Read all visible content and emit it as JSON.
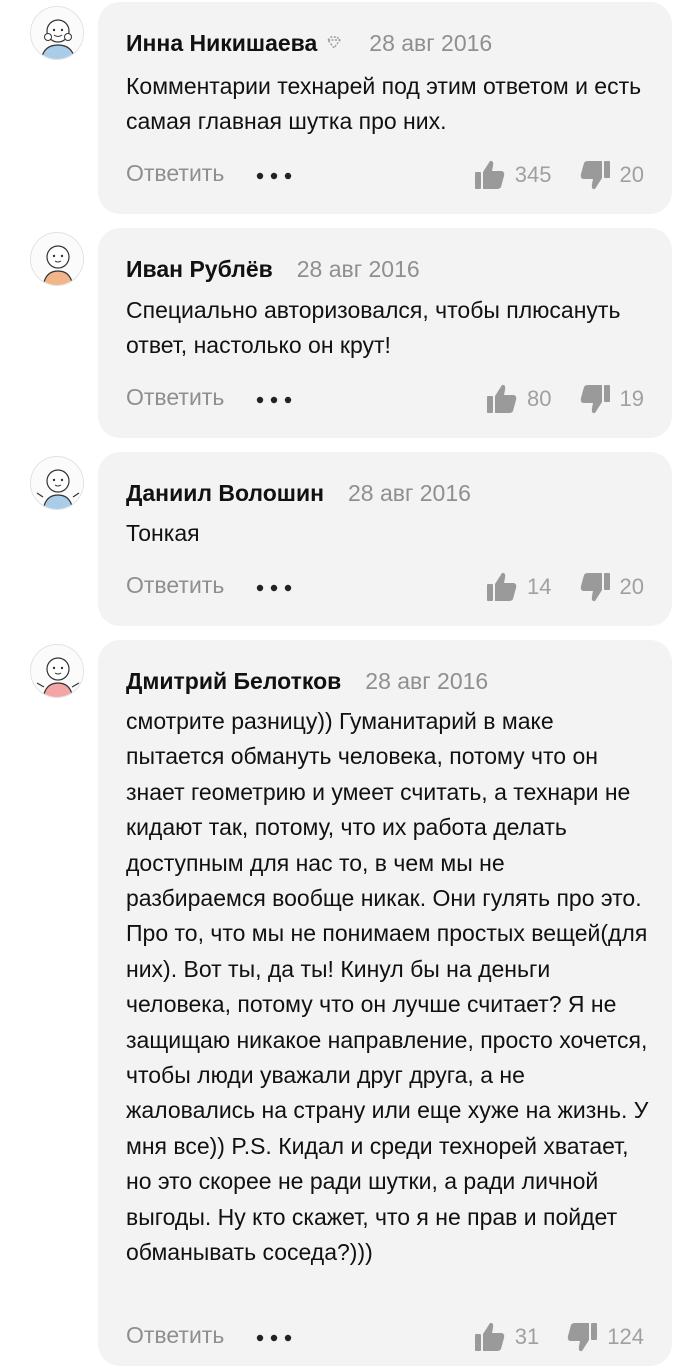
{
  "comments": [
    {
      "author": "Инна Никишаева",
      "has_badge": true,
      "date": "28 авг 2016",
      "text": "Комментарии технарей под этим ответом и есть самая главная шутка про них.",
      "reply_label": "Ответить",
      "likes": "345",
      "dislikes": "20",
      "avatar_shirt_color": "#a9cce8"
    },
    {
      "author": "Иван Рублёв",
      "has_badge": false,
      "date": "28 авг 2016",
      "text": "Специально авторизовался, чтобы плюсануть ответ, настолько он крут!",
      "reply_label": "Ответить",
      "likes": "80",
      "dislikes": "19",
      "avatar_shirt_color": "#f2b58a"
    },
    {
      "author": "Даниил Волошин",
      "has_badge": false,
      "date": "28 авг 2016",
      "text": "Тонкая",
      "reply_label": "Ответить",
      "likes": "14",
      "dislikes": "20",
      "avatar_shirt_color": "#a9cce8"
    },
    {
      "author": "Дмитрий Белотков",
      "has_badge": false,
      "date": "28 авг 2016",
      "text": "смотрите разницу)) Гуманитарий в маке пытается обмануть человека, потому что он знает геометрию и умеет считать, а технари не кидают так, потому, что их работа делать доступным для нас то, в чем мы не разбираемся вообще никак. Они гулять про это. Про то, что мы не понимаем простых вещей(для них). Вот ты, да ты! Кинул бы на деньги человека, потому что он лучше считает? Я не защищаю никакое направление, просто хочется, чтобы люди уважали друг друга, а не жаловались на страну или еще хуже на жизнь. У мня все)) P.S. Кидал и среди технорей хватает, но это скорее не ради шутки, а ради личной выгоды. Ну кто скажет, что я не прав и пойдет обманывать соседа?)))",
      "reply_label": "Ответить",
      "likes": "31",
      "dislikes": "124",
      "avatar_shirt_color": "#f4a6a6"
    }
  ],
  "colors": {
    "bubble": "#f3f3f3",
    "muted": "#8f8f8f",
    "icon": "#9a9a9a"
  },
  "icons": [
    "badge-icon",
    "more-icon",
    "thumbs-up-icon",
    "thumbs-down-icon",
    "avatar-icon"
  ]
}
